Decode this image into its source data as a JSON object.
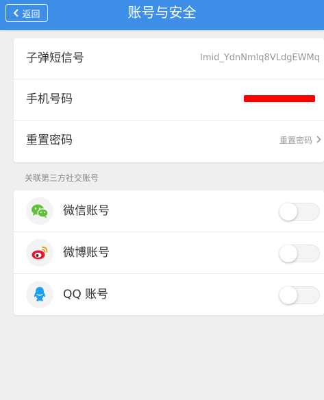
{
  "header": {
    "back_label": "返回",
    "title": "账号与安全"
  },
  "account": {
    "rows": [
      {
        "label": "子弹短信号",
        "value": "lmid_YdnNmlq8VLdgEWMq"
      },
      {
        "label": "手机号码",
        "value": ""
      },
      {
        "label": "重置密码",
        "value": "重置密码"
      }
    ]
  },
  "social": {
    "caption": "关联第三方社交账号",
    "items": [
      {
        "label": "微信账号",
        "icon": "wechat-icon",
        "enabled": false
      },
      {
        "label": "微博账号",
        "icon": "weibo-icon",
        "enabled": false
      },
      {
        "label": "QQ 账号",
        "icon": "qq-icon",
        "enabled": false
      }
    ]
  },
  "colors": {
    "nav": "#3d8ee6",
    "background": "#efeff1",
    "wechat": "#5fc23a",
    "weibo": "#e6162d",
    "qq": "#1ea0f2",
    "redaction": "#ff0000"
  }
}
